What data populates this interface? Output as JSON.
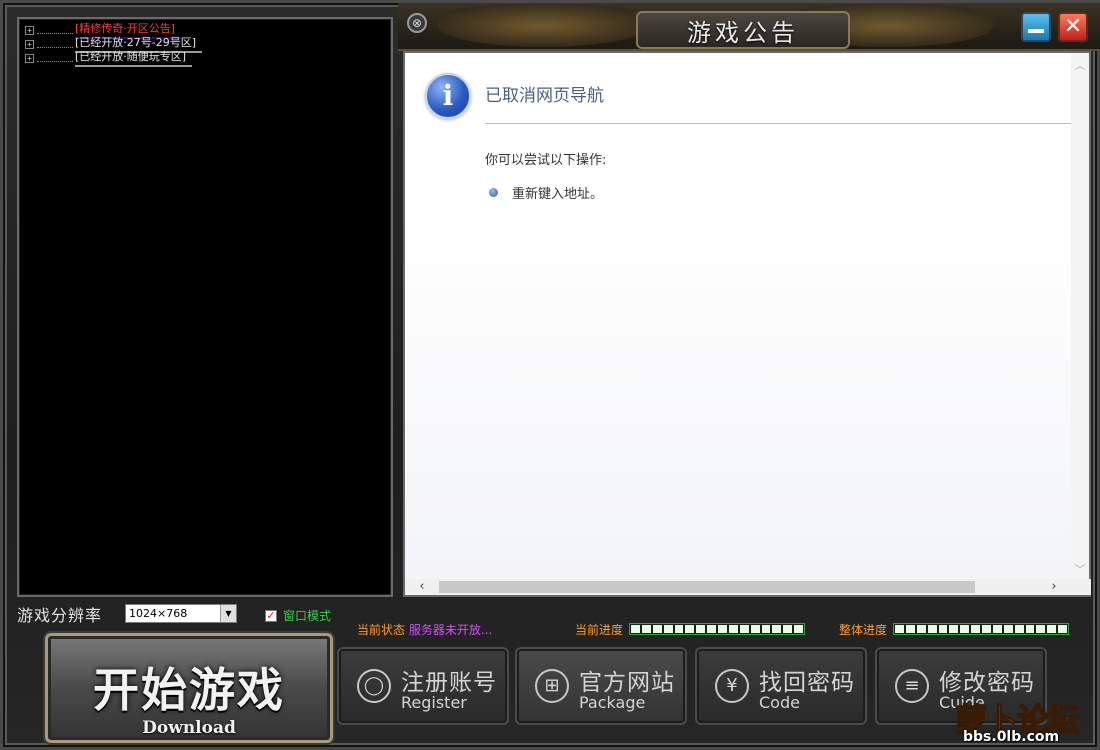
{
  "window": {
    "title": "游戏公告",
    "pin_glyph": "⊗",
    "close_glyph": "✕"
  },
  "server_tree": {
    "items": [
      {
        "label": "[精修传奇·开区公告]",
        "color": "#ff3b3b"
      },
      {
        "label": "[已经开放·27号-29号区]",
        "color": "#e6e6e6"
      },
      {
        "label": "[已经开放·随便玩专区]",
        "color": "#e6e6e6"
      }
    ],
    "expander_glyph": "+"
  },
  "browser": {
    "info_icon_glyph": "i",
    "title": "已取消网页导航",
    "hint": "你可以尝试以下操作:",
    "suggestion": "重新键入地址。",
    "scroll_up": "︿",
    "scroll_down": "﹀",
    "scroll_left": "‹",
    "scroll_right": "›"
  },
  "options": {
    "resolution_label": "游戏分辨率",
    "resolution_value": "1024×768",
    "window_mode_label": "窗口模式",
    "window_mode_checked": true
  },
  "status": {
    "current_status_label": "当前状态",
    "current_status_value": "服务器未开放...",
    "current_progress_label": "当前进度",
    "overall_progress_label": "整体进度",
    "current_progress": 0,
    "overall_progress": 0
  },
  "buttons": {
    "start": {
      "cn": "开始游戏",
      "en": "Download"
    },
    "register": {
      "cn": "注册账号",
      "en": "Register",
      "icon": "user-icon"
    },
    "website": {
      "cn": "官方网站",
      "en": "Package",
      "icon": "gift-icon"
    },
    "recover": {
      "cn": "找回密码",
      "en": "Code",
      "icon": "yen-icon"
    },
    "change": {
      "cn": "修改密码",
      "en": "Cuide",
      "icon": "list-icon"
    }
  },
  "watermark": {
    "cn": "萝卜论坛",
    "url": "bbs.0lb.com"
  },
  "colors": {
    "accent_red": "#ff3b3b",
    "status_orange": "#ff9a2a",
    "status_magenta": "#d84bff",
    "check_green": "#34d04a"
  }
}
